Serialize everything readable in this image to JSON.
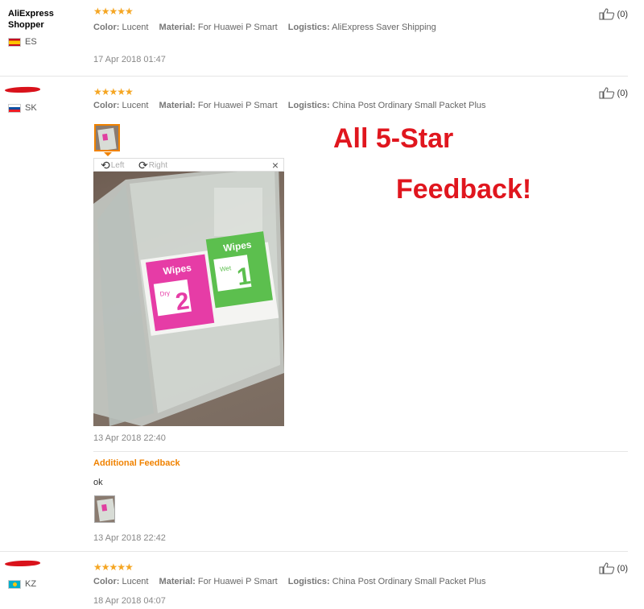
{
  "reviews": [
    {
      "user": "AliExpress Shopper",
      "country": "ES",
      "stars": "★★★★★",
      "color_label": "Color:",
      "color_value": "Lucent",
      "material_label": "Material:",
      "material_value": "For Huawei P Smart",
      "logistics_label": "Logistics:",
      "logistics_value": "AliExpress Saver Shipping",
      "date": "17 Apr 2018 01:47",
      "helpful": "(0)"
    },
    {
      "user": "",
      "country": "SK",
      "stars": "★★★★★",
      "color_label": "Color:",
      "color_value": "Lucent",
      "material_label": "Material:",
      "material_value": "For Huawei P Smart",
      "logistics_label": "Logistics:",
      "logistics_value": "China Post Ordinary Small Packet Plus",
      "date": "13 Apr 2018 22:40",
      "helpful": "(0)",
      "viewer": {
        "rotate_left": "Left",
        "rotate_right": "Right",
        "close": "×"
      },
      "photo_text": {
        "wipes_a": "Wipes",
        "wipes_b": "Wipes",
        "dry": "Dry",
        "wet": "Wet",
        "num_a": "2",
        "num_b": "1"
      },
      "additional_title": "Additional Feedback",
      "additional_text": "ok",
      "additional_date": "13 Apr 2018 22:42"
    },
    {
      "user": "",
      "country": "KZ",
      "stars": "★★★★★",
      "color_label": "Color:",
      "color_value": "Lucent",
      "material_label": "Material:",
      "material_value": "For Huawei P Smart",
      "logistics_label": "Logistics:",
      "logistics_value": "China Post Ordinary Small Packet Plus",
      "date": "18 Apr 2018 04:07",
      "helpful": "(0)"
    }
  ],
  "promo": {
    "line1": "All 5-Star",
    "line2": "Feedback!"
  },
  "colors": {
    "star": "#f5a623",
    "accent_orange": "#f08200",
    "promo_red": "#e0161e",
    "redaction": "#d9121b"
  },
  "icons": [
    "thumbs-up-icon",
    "rotate-left-icon",
    "rotate-right-icon",
    "close-icon",
    "flag-es-icon",
    "flag-sk-icon",
    "flag-kz-icon"
  ]
}
